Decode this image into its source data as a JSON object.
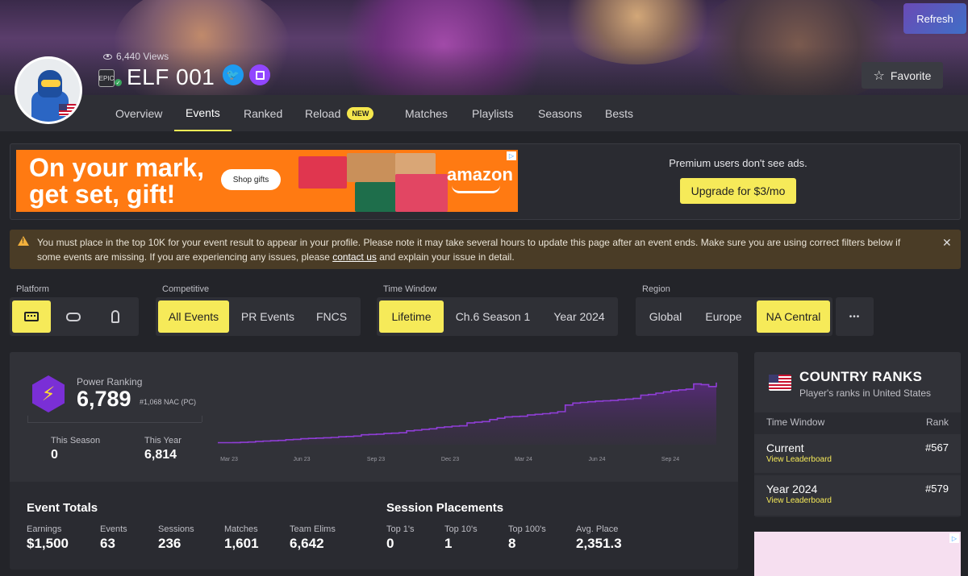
{
  "header": {
    "refresh_label": "Refresh",
    "views": "6,440 Views",
    "player_name": "ELF 001",
    "favorite_label": "Favorite"
  },
  "nav": {
    "tabs": [
      {
        "label": "Overview"
      },
      {
        "label": "Events",
        "active": true
      },
      {
        "label": "Ranked"
      },
      {
        "label": "Reload",
        "badge": "NEW"
      },
      {
        "label": "Matches"
      },
      {
        "label": "Playlists"
      },
      {
        "label": "Seasons"
      },
      {
        "label": "Bests"
      }
    ]
  },
  "ad": {
    "headline": "On your mark,\nget set, gift!",
    "shop_button": "Shop gifts",
    "brand": "amazon",
    "premium_text": "Premium users don't see ads.",
    "upgrade_label": "Upgrade for $3/mo"
  },
  "alert": {
    "text_before": "You must place in the top 10K for your event result to appear in your profile. Please note it may take several hours to update this page after an event ends. Make sure you are using correct filters below if some events are missing. If you are experiencing any issues, please ",
    "link": "contact us",
    "text_after": " and explain your issue in detail."
  },
  "filters": {
    "platform": {
      "label": "Platform"
    },
    "competitive": {
      "label": "Competitive",
      "options": [
        "All Events",
        "PR Events",
        "FNCS"
      ],
      "selected": "All Events"
    },
    "time_window": {
      "label": "Time Window",
      "options": [
        "Lifetime",
        "Ch.6 Season 1",
        "Year 2024"
      ],
      "selected": "Lifetime"
    },
    "region": {
      "label": "Region",
      "options": [
        "Global",
        "Europe",
        "NA Central"
      ],
      "selected": "NA Central",
      "more": "•••"
    }
  },
  "power_ranking": {
    "label": "Power Ranking",
    "value": "6,789",
    "rank": "#1,068 NAC (PC)",
    "this_season_label": "This Season",
    "this_season_value": "0",
    "this_year_label": "This Year",
    "this_year_value": "6,814"
  },
  "chart_data": {
    "type": "area",
    "x_ticks": [
      "Mar 23",
      "Jun 23",
      "Sep 23",
      "Dec 23",
      "Mar 24",
      "Jun 24",
      "Sep 24"
    ],
    "values": [
      3,
      3,
      3.2,
      3.5,
      4,
      5,
      5.5,
      6,
      6.5,
      7.5,
      8,
      9,
      9.5,
      10,
      10.5,
      11,
      12,
      12.5,
      13,
      15,
      15.5,
      16,
      17,
      17.5,
      18,
      21,
      22,
      23,
      24,
      26,
      27,
      28,
      28.5,
      33,
      34,
      35,
      38,
      40,
      42,
      42.5,
      43,
      45,
      46,
      47,
      48,
      50,
      60,
      63,
      64,
      65,
      66,
      66.5,
      67,
      68,
      69,
      70,
      75,
      76,
      78,
      80,
      82,
      83,
      84,
      92,
      91,
      88,
      94
    ],
    "color": "#8f3ed6"
  },
  "event_totals": {
    "title": "Event Totals",
    "stats": [
      {
        "label": "Earnings",
        "value": "$1,500"
      },
      {
        "label": "Events",
        "value": "63"
      },
      {
        "label": "Sessions",
        "value": "236"
      },
      {
        "label": "Matches",
        "value": "1,601"
      },
      {
        "label": "Team Elims",
        "value": "6,642"
      }
    ]
  },
  "session_placements": {
    "title": "Session Placements",
    "stats": [
      {
        "label": "Top 1's",
        "value": "0"
      },
      {
        "label": "Top 10's",
        "value": "1"
      },
      {
        "label": "Top 100's",
        "value": "8"
      },
      {
        "label": "Avg. Place",
        "value": "2,351.3"
      }
    ]
  },
  "country_ranks": {
    "title": "COUNTRY RANKS",
    "subtitle": "Player's ranks in United States",
    "col_time": "Time Window",
    "col_rank": "Rank",
    "rows": [
      {
        "period": "Current",
        "link": "View Leaderboard",
        "rank": "#567"
      },
      {
        "period": "Year 2024",
        "link": "View Leaderboard",
        "rank": "#579"
      }
    ]
  }
}
